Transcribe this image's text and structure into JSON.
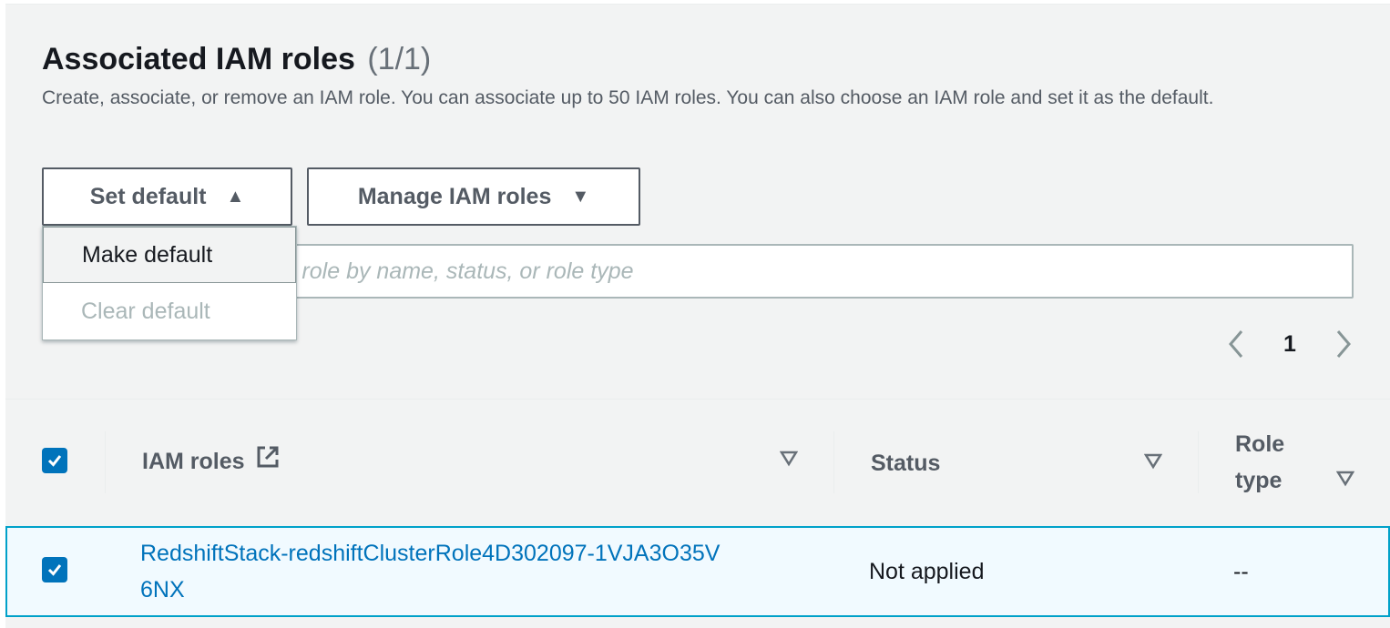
{
  "section": {
    "title": "Associated IAM roles",
    "count": "(1/1)",
    "description": "Create, associate, or remove an IAM role. You can associate up to 50 IAM roles. You can also choose an IAM role and set it as the default."
  },
  "actions": {
    "set_default_label": "Set default",
    "manage_label": "Manage IAM roles"
  },
  "set_default_menu": {
    "items": [
      {
        "label": "Make default",
        "state": "highlighted"
      },
      {
        "label": "Clear default",
        "state": "disabled"
      }
    ]
  },
  "search": {
    "placeholder": "Find associated IAM role by name, status, or role type",
    "value": ""
  },
  "pagination": {
    "current_page": "1"
  },
  "table": {
    "columns": [
      "IAM roles",
      "Status",
      "Role\ntype"
    ],
    "header_checked": true,
    "rows": [
      {
        "checked": true,
        "iam_role": "RedshiftStack-redshiftClusterRole4D302097-1VJA3O35V6NX",
        "status": "Not applied",
        "role_type": "--"
      }
    ]
  },
  "colors": {
    "link": "#0073bb",
    "selected_row_bg": "#f1faff",
    "selected_row_border": "#00a1c9",
    "checkbox": "#0073bb"
  }
}
